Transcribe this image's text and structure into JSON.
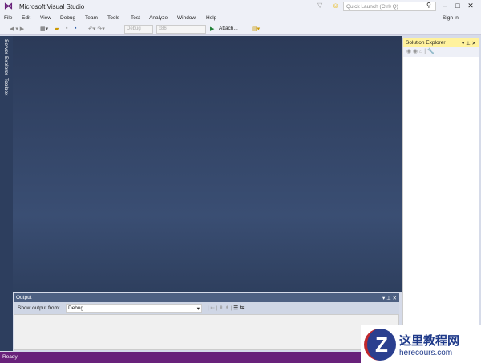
{
  "window": {
    "title": "Microsoft Visual Studio",
    "quick_launch_placeholder": "Quick Launch (Ctrl+Q)",
    "sign_in": "Sign in"
  },
  "menu": [
    "File",
    "Edit",
    "View",
    "Debug",
    "Team",
    "Tools",
    "Test",
    "Analyze",
    "Window",
    "Help"
  ],
  "toolbar": {
    "config": "Debug",
    "platform": "x86",
    "attach": "Attach..."
  },
  "side_tabs": [
    "Server Explorer",
    "Toolbox"
  ],
  "solution_explorer": {
    "title": "Solution Explorer"
  },
  "output": {
    "title": "Output",
    "show_from_label": "Show output from:",
    "source": "Debug"
  },
  "status": {
    "text": "Ready"
  },
  "watermark": {
    "name": "这里教程网",
    "url": "herecours.com"
  }
}
